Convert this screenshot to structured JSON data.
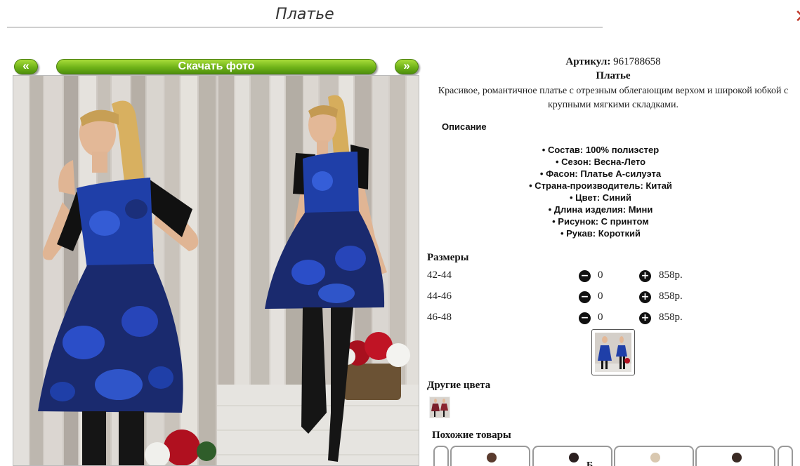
{
  "page": {
    "title": "Платье"
  },
  "nav": {
    "prev": "«",
    "next": "»",
    "download": "Скачать фото"
  },
  "product": {
    "article_label": "Артикул:",
    "article_value": "961788658",
    "name": "Платье",
    "short_desc": "Красивое, романтичное платье с отрезным облегающим верхом и широкой юбкой с крупными мягкими складками."
  },
  "description": {
    "title": "Описание",
    "features": [
      "Состав: 100% полиэстер",
      "Сезон: Весна-Лето",
      "Фасон: Платье А-силуэта",
      "Страна-производитель: Китай",
      "Цвет: Синий",
      "Длина изделия: Мини",
      "Рисунок: С принтом",
      "Рукав: Короткий"
    ]
  },
  "sizes": {
    "title": "Размеры",
    "rows": [
      {
        "size": "42-44",
        "qty": "0",
        "price": "858р."
      },
      {
        "size": "44-46",
        "qty": "0",
        "price": "858р."
      },
      {
        "size": "46-48",
        "qty": "0",
        "price": "858р."
      }
    ]
  },
  "other_colors": {
    "title": "Другие цвета"
  },
  "similar": {
    "title": "Похожие товары",
    "partial_label": "Б..."
  },
  "colors": {
    "accent_green": "#6fb318",
    "dress_blue": "#1f3fa8",
    "close_red": "#c0392b"
  }
}
